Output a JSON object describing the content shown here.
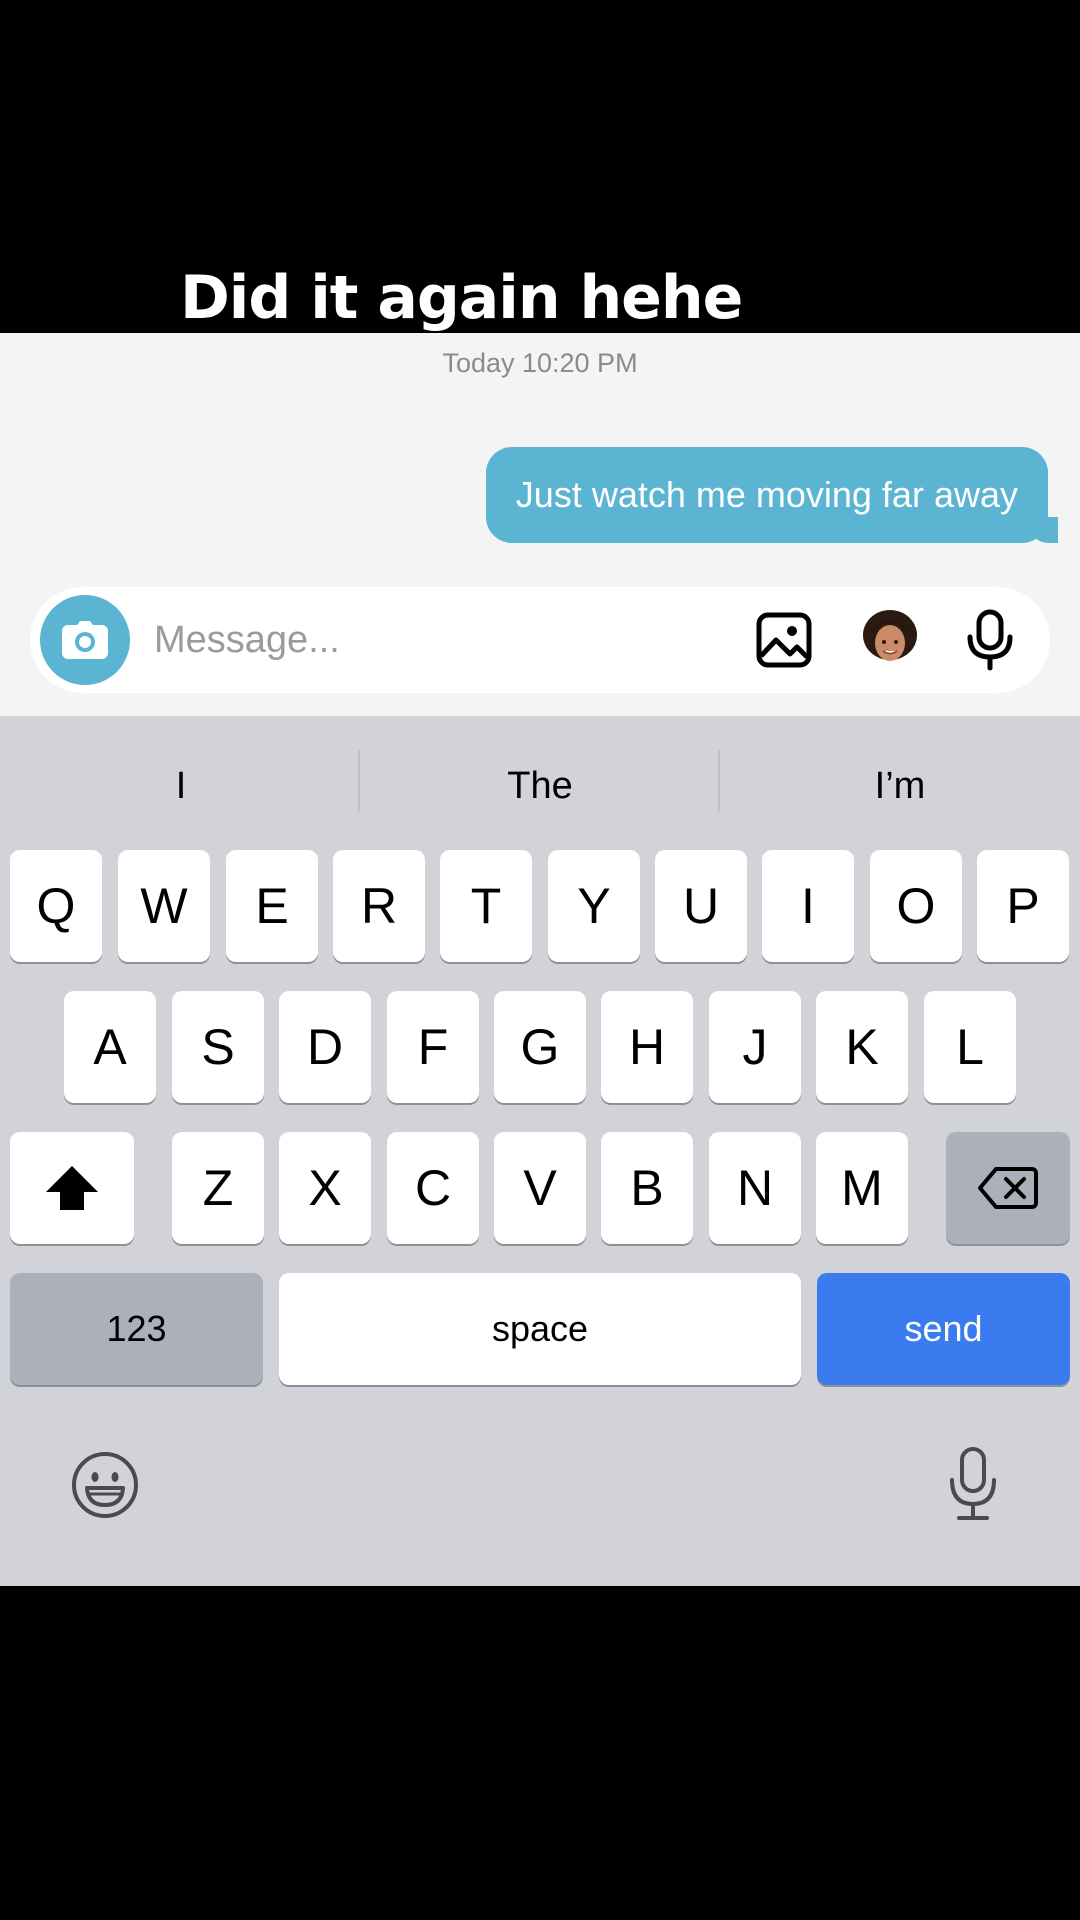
{
  "caption": "Did it again hehe",
  "chat": {
    "timestamp": "Today 10:20 PM",
    "messages": [
      {
        "text": "Just watch me moving far away",
        "direction": "outgoing"
      }
    ]
  },
  "composer": {
    "placeholder": "Message...",
    "icons": [
      "camera-icon",
      "gallery-icon",
      "avatar",
      "microphone-icon"
    ]
  },
  "keyboard": {
    "suggestions": [
      "I",
      "The",
      "I’m"
    ],
    "row1": [
      "Q",
      "W",
      "E",
      "R",
      "T",
      "Y",
      "U",
      "I",
      "O",
      "P"
    ],
    "row2": [
      "A",
      "S",
      "D",
      "F",
      "G",
      "H",
      "J",
      "K",
      "L"
    ],
    "row3": [
      "Z",
      "X",
      "C",
      "V",
      "B",
      "N",
      "M"
    ],
    "numbers_label": "123",
    "space_label": "space",
    "send_label": "send",
    "icons": [
      "shift-icon",
      "backspace-icon",
      "emoji-icon",
      "dictation-icon"
    ]
  },
  "colors": {
    "bubble": "#5ab4d2",
    "send_key": "#3a7bef",
    "keyboard_bg": "#d1d3d9"
  }
}
